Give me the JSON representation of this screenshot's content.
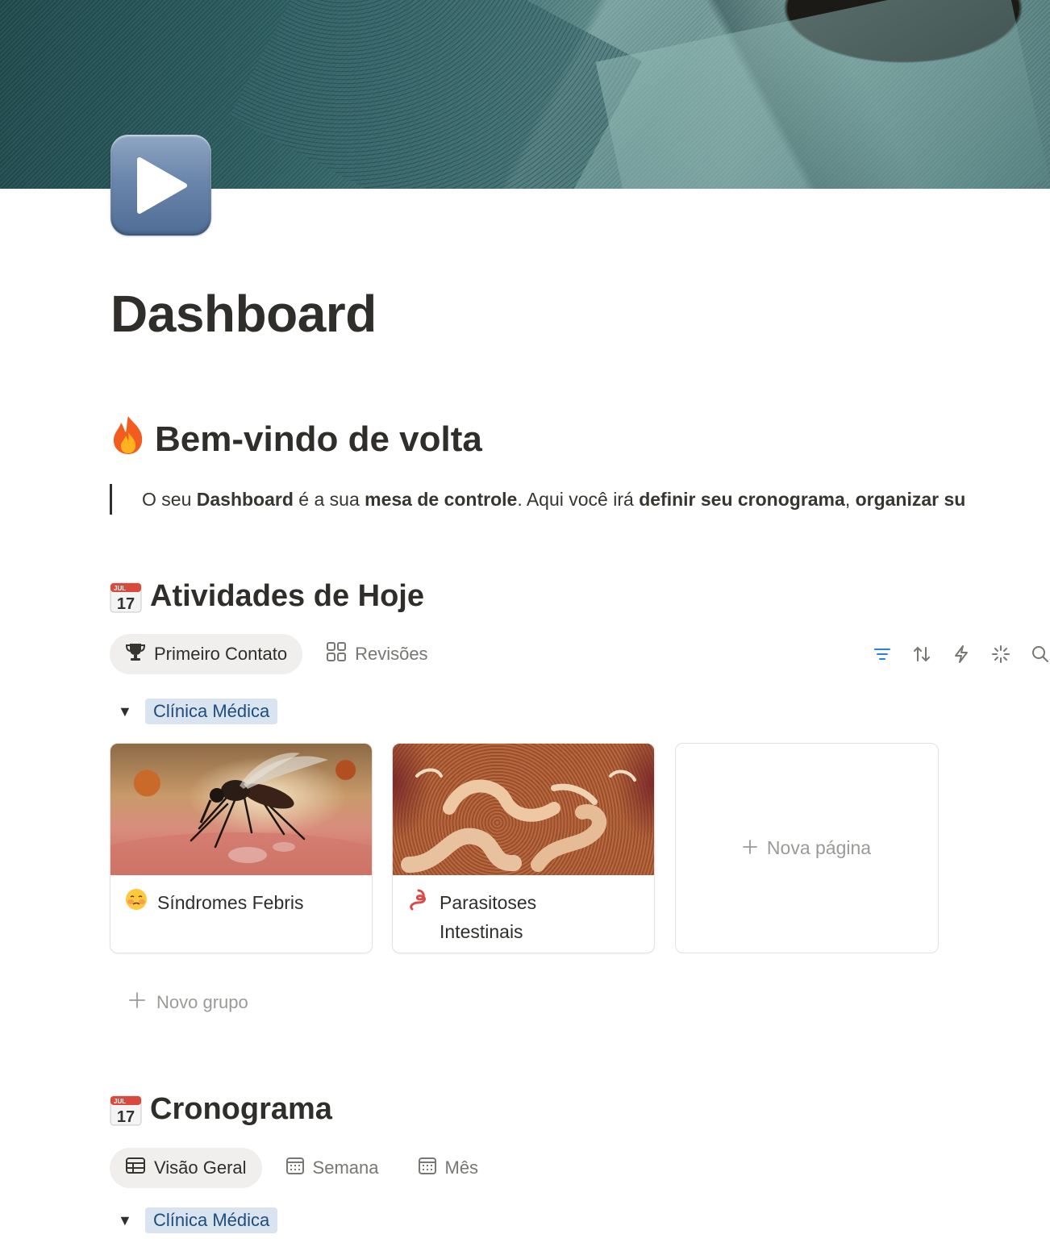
{
  "page": {
    "title": "Dashboard",
    "icon": "play-button-icon"
  },
  "welcome": {
    "heading": "Bem-vindo de volta",
    "icon": "fire-icon",
    "quote": [
      {
        "text": "O seu ",
        "bold": false
      },
      {
        "text": "Dashboard",
        "bold": true
      },
      {
        "text": " é a sua ",
        "bold": false
      },
      {
        "text": "mesa de controle",
        "bold": true
      },
      {
        "text": ". Aqui você irá ",
        "bold": false
      },
      {
        "text": "definir seu cronograma",
        "bold": true
      },
      {
        "text": ", ",
        "bold": false
      },
      {
        "text": "organizar su",
        "bold": true
      }
    ]
  },
  "today": {
    "heading": "Atividades de Hoje",
    "icon": "calendar-icon",
    "calendar_icon_month": "JUL",
    "calendar_icon_day": "17",
    "tabs": [
      {
        "label": "Primeiro Contato",
        "icon": "trophy-icon",
        "active": true
      },
      {
        "label": "Revisões",
        "icon": "gallery-icon",
        "active": false
      }
    ],
    "toolbar": [
      "filter-icon",
      "sort-icon",
      "automation-icon",
      "ai-sparkle-icon",
      "search-icon"
    ],
    "group": {
      "label": "Clínica Médica",
      "color": "#d9e4f0"
    },
    "cards": [
      {
        "title": "Síndromes Febris",
        "icon": "feverish-face-icon",
        "image": "mosquito-image"
      },
      {
        "title": "Parasitoses Intestinais",
        "icon": "worm-icon",
        "image": "worms-image"
      }
    ],
    "new_page": "Nova página",
    "new_group": "Novo grupo"
  },
  "schedule": {
    "heading": "Cronograma",
    "icon": "calendar-icon",
    "calendar_icon_month": "JUL",
    "calendar_icon_day": "17",
    "tabs": [
      {
        "label": "Visão Geral",
        "icon": "table-icon",
        "active": true
      },
      {
        "label": "Semana",
        "icon": "calendar-view-icon",
        "active": false
      },
      {
        "label": "Mês",
        "icon": "calendar-view-icon",
        "active": false
      }
    ],
    "group": {
      "label": "Clínica Médica",
      "color": "#d9e4f0"
    }
  },
  "colors": {
    "accent_blue": "#2383e2",
    "tag_bg": "#d9e4f0",
    "tag_text": "#1f4d7a"
  }
}
